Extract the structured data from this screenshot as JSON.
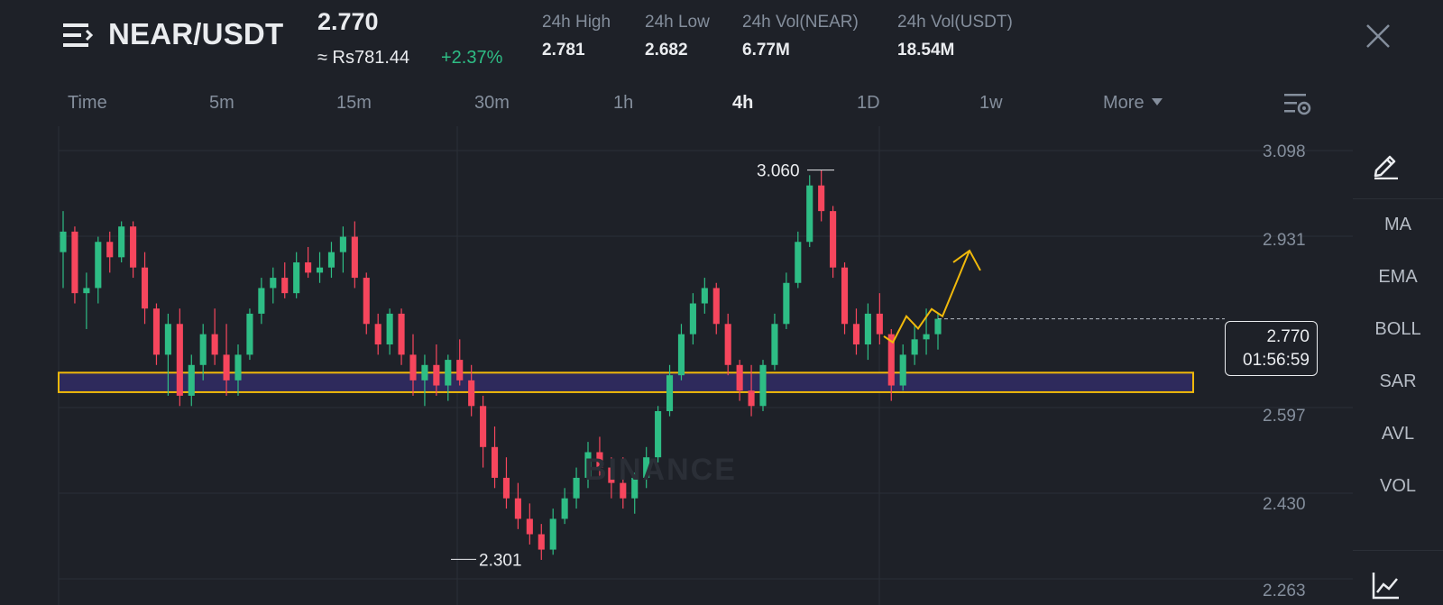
{
  "header": {
    "pair": "NEAR/USDT",
    "price": "2.770",
    "fiat_price": "≈ Rs781.44",
    "change": "+2.37%",
    "stats": [
      {
        "label": "24h High",
        "value": "2.781"
      },
      {
        "label": "24h Low",
        "value": "2.682"
      },
      {
        "label": "24h Vol(NEAR)",
        "value": "6.77M"
      },
      {
        "label": "24h Vol(USDT)",
        "value": "18.54M"
      }
    ]
  },
  "tabs": [
    {
      "label": "Time",
      "active": false
    },
    {
      "label": "5m",
      "active": false
    },
    {
      "label": "15m",
      "active": false
    },
    {
      "label": "30m",
      "active": false
    },
    {
      "label": "1h",
      "active": false
    },
    {
      "label": "4h",
      "active": true
    },
    {
      "label": "1D",
      "active": false
    },
    {
      "label": "1w",
      "active": false
    },
    {
      "label": "More",
      "active": false
    }
  ],
  "icons": {
    "menu": "menu-icon",
    "close": "close-icon",
    "settings": "chart-settings-icon",
    "pencil": "pencil-icon",
    "indicator": "indicator-chart-icon"
  },
  "sidebar": {
    "items": [
      "MA",
      "EMA",
      "BOLL",
      "SAR",
      "AVL",
      "VOL"
    ]
  },
  "chart_data": {
    "type": "candlestick",
    "pair": "NEAR/USDT",
    "interval": "4h",
    "y_ticks": [
      "3.098",
      "2.931",
      "2.597",
      "2.430",
      "2.263"
    ],
    "ylim": [
      2.26,
      3.12
    ],
    "high_label": "3.060",
    "low_label": "2.301",
    "current_price": "2.770",
    "countdown": "01:56:59",
    "watermark": "BINANCE",
    "support_zone": [
      2.627,
      2.665
    ],
    "projection": [
      [
        2.736,
        2.724,
        2.775,
        2.751,
        2.789,
        2.775,
        2.903
      ]
    ],
    "ohlc": [
      [
        2.9,
        2.98,
        2.83,
        2.94
      ],
      [
        2.94,
        2.95,
        2.8,
        2.82
      ],
      [
        2.82,
        2.86,
        2.75,
        2.83
      ],
      [
        2.83,
        2.93,
        2.8,
        2.92
      ],
      [
        2.92,
        2.94,
        2.86,
        2.89
      ],
      [
        2.89,
        2.96,
        2.88,
        2.95
      ],
      [
        2.95,
        2.96,
        2.85,
        2.87
      ],
      [
        2.87,
        2.9,
        2.76,
        2.79
      ],
      [
        2.79,
        2.8,
        2.68,
        2.7
      ],
      [
        2.7,
        2.78,
        2.62,
        2.76
      ],
      [
        2.76,
        2.79,
        2.6,
        2.62
      ],
      [
        2.62,
        2.7,
        2.6,
        2.68
      ],
      [
        2.68,
        2.76,
        2.65,
        2.74
      ],
      [
        2.74,
        2.79,
        2.68,
        2.7
      ],
      [
        2.7,
        2.76,
        2.62,
        2.65
      ],
      [
        2.65,
        2.72,
        2.62,
        2.7
      ],
      [
        2.7,
        2.79,
        2.69,
        2.78
      ],
      [
        2.78,
        2.85,
        2.76,
        2.83
      ],
      [
        2.83,
        2.87,
        2.8,
        2.85
      ],
      [
        2.85,
        2.88,
        2.81,
        2.82
      ],
      [
        2.82,
        2.9,
        2.81,
        2.88
      ],
      [
        2.88,
        2.91,
        2.85,
        2.86
      ],
      [
        2.86,
        2.9,
        2.84,
        2.87
      ],
      [
        2.87,
        2.92,
        2.85,
        2.9
      ],
      [
        2.9,
        2.95,
        2.86,
        2.93
      ],
      [
        2.93,
        2.96,
        2.83,
        2.85
      ],
      [
        2.85,
        2.86,
        2.74,
        2.76
      ],
      [
        2.76,
        2.78,
        2.7,
        2.72
      ],
      [
        2.72,
        2.79,
        2.7,
        2.78
      ],
      [
        2.78,
        2.79,
        2.68,
        2.7
      ],
      [
        2.7,
        2.74,
        2.62,
        2.65
      ],
      [
        2.65,
        2.7,
        2.6,
        2.68
      ],
      [
        2.68,
        2.72,
        2.62,
        2.64
      ],
      [
        2.64,
        2.7,
        2.61,
        2.69
      ],
      [
        2.69,
        2.73,
        2.64,
        2.65
      ],
      [
        2.65,
        2.68,
        2.58,
        2.6
      ],
      [
        2.6,
        2.62,
        2.48,
        2.52
      ],
      [
        2.52,
        2.56,
        2.44,
        2.46
      ],
      [
        2.46,
        2.5,
        2.4,
        2.42
      ],
      [
        2.42,
        2.45,
        2.36,
        2.38
      ],
      [
        2.38,
        2.41,
        2.33,
        2.35
      ],
      [
        2.35,
        2.37,
        2.3,
        2.32
      ],
      [
        2.32,
        2.4,
        2.31,
        2.38
      ],
      [
        2.38,
        2.44,
        2.37,
        2.42
      ],
      [
        2.42,
        2.48,
        2.4,
        2.46
      ],
      [
        2.46,
        2.53,
        2.44,
        2.51
      ],
      [
        2.51,
        2.54,
        2.46,
        2.48
      ],
      [
        2.48,
        2.5,
        2.42,
        2.45
      ],
      [
        2.45,
        2.5,
        2.4,
        2.42
      ],
      [
        2.42,
        2.47,
        2.39,
        2.46
      ],
      [
        2.46,
        2.52,
        2.44,
        2.5
      ],
      [
        2.5,
        2.6,
        2.49,
        2.59
      ],
      [
        2.59,
        2.68,
        2.58,
        2.66
      ],
      [
        2.66,
        2.76,
        2.65,
        2.74
      ],
      [
        2.74,
        2.82,
        2.72,
        2.8
      ],
      [
        2.8,
        2.85,
        2.78,
        2.83
      ],
      [
        2.83,
        2.84,
        2.74,
        2.76
      ],
      [
        2.76,
        2.78,
        2.66,
        2.68
      ],
      [
        2.68,
        2.69,
        2.61,
        2.63
      ],
      [
        2.63,
        2.68,
        2.58,
        2.6
      ],
      [
        2.6,
        2.69,
        2.59,
        2.68
      ],
      [
        2.68,
        2.78,
        2.67,
        2.76
      ],
      [
        2.76,
        2.86,
        2.75,
        2.84
      ],
      [
        2.84,
        2.94,
        2.83,
        2.92
      ],
      [
        2.92,
        3.05,
        2.91,
        3.03
      ],
      [
        3.03,
        3.06,
        2.96,
        2.98
      ],
      [
        2.98,
        2.99,
        2.85,
        2.87
      ],
      [
        2.87,
        2.88,
        2.74,
        2.76
      ],
      [
        2.76,
        2.79,
        2.7,
        2.72
      ],
      [
        2.72,
        2.8,
        2.69,
        2.78
      ],
      [
        2.78,
        2.82,
        2.72,
        2.74
      ],
      [
        2.74,
        2.75,
        2.61,
        2.64
      ],
      [
        2.64,
        2.72,
        2.63,
        2.7
      ],
      [
        2.7,
        2.76,
        2.68,
        2.73
      ],
      [
        2.73,
        2.79,
        2.7,
        2.74
      ],
      [
        2.74,
        2.78,
        2.71,
        2.77
      ]
    ]
  }
}
